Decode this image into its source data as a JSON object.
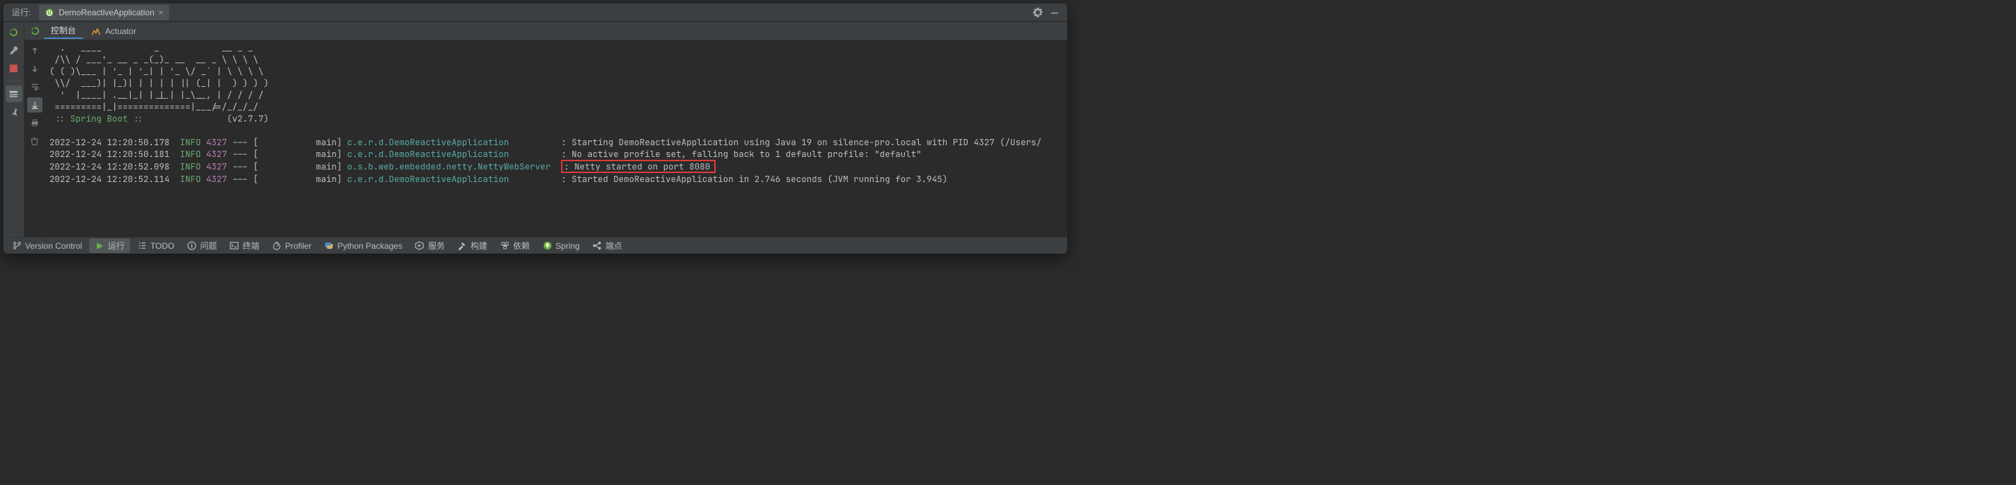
{
  "title": {
    "run_label": "运行:"
  },
  "run_tab": {
    "label": "DemoReactiveApplication"
  },
  "sub_tabs": {
    "console": "控制台",
    "actuator": "Actuator"
  },
  "banner": {
    "l1": "  .   ____          _            __ _ _",
    "l2": " /\\\\ / ___'_ __ _ _(_)_ __  __ _ \\ \\ \\ \\",
    "l3": "( ( )\\___ | '_ | '_| | '_ \\/ _` | \\ \\ \\ \\",
    "l4": " \\\\/  ___)| |_)| | | | | || (_| |  ) ) ) )",
    "l5": "  '  |____| .__|_| |_|_| |_\\__, | / / / /",
    "l6": " =========|_|==============|___/=/_/_/_/",
    "name": " :: Spring Boot :: ",
    "version": "(v2.7.7)"
  },
  "log": {
    "rows": [
      {
        "ts": "2022-12-24 12:20:50.178",
        "level": "INFO",
        "pid": "4327",
        "sep": " --- [           ",
        "thread": "main] ",
        "logger": "c.e.r.d.DemoReactiveApplication",
        "pad": "         ",
        "msg": " Starting DemoReactiveApplication using Java 19 on silence-pro.local with PID 4327 (/Users/",
        "hl": false
      },
      {
        "ts": "2022-12-24 12:20:50.181",
        "level": "INFO",
        "pid": "4327",
        "sep": " --- [           ",
        "thread": "main] ",
        "logger": "c.e.r.d.DemoReactiveApplication",
        "pad": "         ",
        "msg": " No active profile set, falling back to 1 default profile: \"default\"",
        "hl": false
      },
      {
        "ts": "2022-12-24 12:20:52.098",
        "level": "INFO",
        "pid": "4327",
        "sep": " --- [           ",
        "thread": "main] ",
        "logger": "o.s.b.web.embedded.netty.NettyWebServer",
        "pad": " ",
        "msg": " Netty started on port 8080",
        "hl": true
      },
      {
        "ts": "2022-12-24 12:20:52.114",
        "level": "INFO",
        "pid": "4327",
        "sep": " --- [           ",
        "thread": "main] ",
        "logger": "c.e.r.d.DemoReactiveApplication",
        "pad": "         ",
        "msg": " Started DemoReactiveApplication in 2.746 seconds (JVM running for 3.945)",
        "hl": false
      }
    ]
  },
  "status": {
    "version_control": "Version Control",
    "run": "运行",
    "todo": "TODO",
    "problems": "问题",
    "terminal": "终端",
    "profiler": "Profiler",
    "python_packages": "Python Packages",
    "services": "服务",
    "build": "构建",
    "deps": "依赖",
    "spring": "Spring",
    "endpoints": "端点"
  }
}
